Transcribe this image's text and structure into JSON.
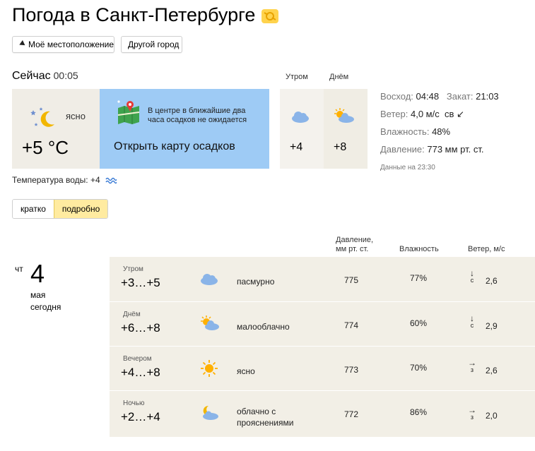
{
  "header": {
    "title": "Погода в Санкт-Петербурге"
  },
  "buttons": {
    "my_location": "Моё местоположение",
    "other_city": "Другой город"
  },
  "now": {
    "label": "Сейчас",
    "time": "00:05",
    "condition": "ясно",
    "temperature": "+5 °C"
  },
  "map": {
    "text": "В центре в ближайшие два часа осадков не ожидается",
    "link": "Открыть карту осадков"
  },
  "forecast_short": {
    "morning_label": "Утром",
    "day_label": "Днём",
    "morning_temp": "+4",
    "day_temp": "+8"
  },
  "stats": {
    "sunrise_label": "Восход:",
    "sunrise": "04:48",
    "sunset_label": "Закат:",
    "sunset": "21:03",
    "wind_label": "Ветер:",
    "wind": "4,0 м/с",
    "wind_dir": "св ↙",
    "humidity_label": "Влажность:",
    "humidity": "48%",
    "pressure_label": "Давление:",
    "pressure": "773 мм рт. ст.",
    "data_note": "Данные на 23:30"
  },
  "water": {
    "label": "Температура воды:",
    "value": "+4"
  },
  "tabs": {
    "short": "кратко",
    "detailed": "подробно"
  },
  "table": {
    "headers": {
      "pressure_line1": "Давление,",
      "pressure_line2": "мм рт. ст.",
      "humidity": "Влажность",
      "wind": "Ветер, м/с"
    },
    "date": {
      "dow": "чт",
      "day": "4",
      "month": "мая",
      "today": "сегодня"
    },
    "rows": [
      {
        "part": "Утром",
        "temps": "+3…+5",
        "icon": "cloudy-icon",
        "desc1": "пасмурно",
        "desc2": "",
        "pressure": "775",
        "humidity": "77%",
        "wind_arrow": "↓",
        "wind_dir": "с",
        "wind_speed": "2,6"
      },
      {
        "part": "Днём",
        "temps": "+6…+8",
        "icon": "partly-cloudy-icon",
        "desc1": "малооблачно",
        "desc2": "",
        "pressure": "774",
        "humidity": "60%",
        "wind_arrow": "↓",
        "wind_dir": "с",
        "wind_speed": "2,9"
      },
      {
        "part": "Вечером",
        "temps": "+4…+8",
        "icon": "sun-icon",
        "desc1": "ясно",
        "desc2": "",
        "pressure": "773",
        "humidity": "70%",
        "wind_arrow": "→",
        "wind_dir": "з",
        "wind_speed": "2,6"
      },
      {
        "part": "Ночью",
        "temps": "+2…+4",
        "icon": "night-cloud-icon",
        "desc1": "облачно с",
        "desc2": "прояснениями",
        "pressure": "772",
        "humidity": "86%",
        "wind_arrow": "→",
        "wind_dir": "з",
        "wind_speed": "2,0"
      }
    ]
  },
  "colors": {
    "map_bg": "#9ecbf5",
    "card_bg": "#f0ede6",
    "row_bg": "#f2efe6",
    "tab_active": "#ffeba0",
    "sun": "#ffb000",
    "cloud": "#8ab4e8"
  }
}
